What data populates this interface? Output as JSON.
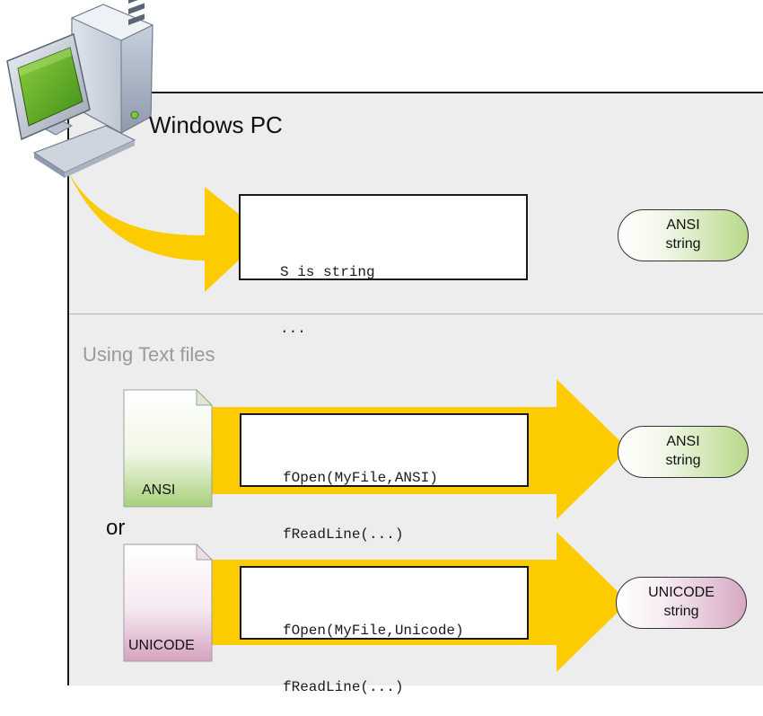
{
  "platform_label": "Windows PC",
  "section_label": "Using Text files",
  "or_label": "or",
  "rows": [
    {
      "code_lines": [
        "S is string",
        "..."
      ],
      "result": [
        "ANSI",
        "string"
      ]
    },
    {
      "file_label": "ANSI",
      "code_lines": [
        "fOpen(MyFile,ANSI)",
        "fReadLine(...)"
      ],
      "result": [
        "ANSI",
        "string"
      ]
    },
    {
      "file_label": "UNICODE",
      "code_lines": [
        "fOpen(MyFile,Unicode)",
        "fReadLine(...)"
      ],
      "result": [
        "UNICODE",
        "string"
      ]
    }
  ],
  "colors": {
    "arrow": "#fccc00",
    "panel": "#ededee",
    "ansi_accent": "#b7d98b",
    "unicode_accent": "#d7a8c4",
    "section_text": "#9a9a9a"
  },
  "icons": [
    "desktop-computer-icon",
    "ansi-file-icon",
    "unicode-file-icon"
  ]
}
